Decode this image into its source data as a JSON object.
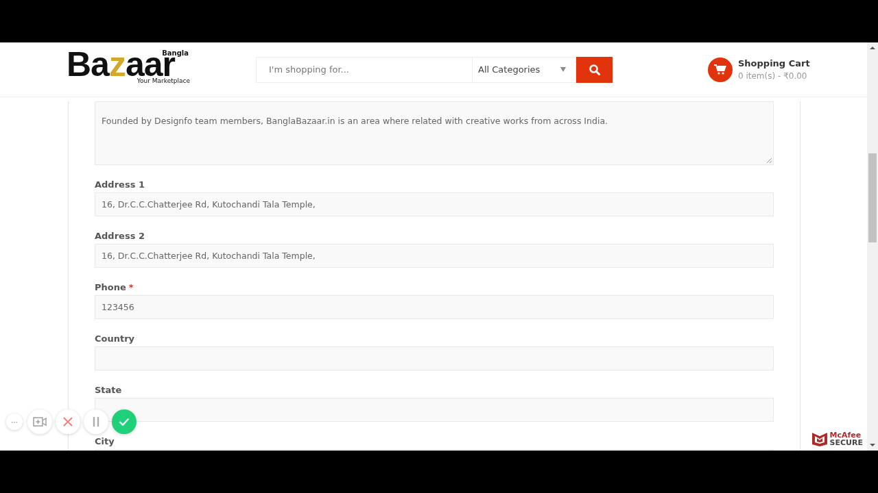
{
  "header": {
    "logo": {
      "small": "Bangla",
      "wordmark": [
        {
          "text": "Ba",
          "accent": false
        },
        {
          "text": "z",
          "accent": true
        },
        {
          "text": "aar",
          "accent": false
        }
      ],
      "tagline": "Your Marketplace"
    },
    "search": {
      "placeholder": "I'm shopping for...",
      "category": "All Categories"
    },
    "cart": {
      "title": "Shopping Cart",
      "summary": "0 item(s) - ₹0.00"
    }
  },
  "form": {
    "required_mark": "*",
    "fields": [
      {
        "kind": "textarea",
        "value": "Founded by Designfo team members, BanglaBazaar.in is an area where related with creative works from across India."
      },
      {
        "label": "Address 1",
        "kind": "input",
        "value": "16, Dr.C.C.Chatterjee Rd, Kutochandi Tala Temple,",
        "required": false
      },
      {
        "label": "Address 2",
        "kind": "input",
        "value": "16, Dr.C.C.Chatterjee Rd, Kutochandi Tala Temple,",
        "required": false
      },
      {
        "label": "Phone",
        "kind": "input",
        "value": "123456",
        "required": true
      },
      {
        "label": "Country",
        "kind": "input",
        "required": false
      },
      {
        "label": "State",
        "kind": "input",
        "required": false
      },
      {
        "label": "City",
        "kind": "input",
        "required": false
      }
    ]
  },
  "recorder": {
    "buttons": [
      {
        "kind": "more",
        "label": "···"
      },
      {
        "kind": "camera"
      },
      {
        "kind": "cancel"
      },
      {
        "kind": "pause"
      },
      {
        "kind": "done"
      }
    ]
  },
  "badge": {
    "brand": "McAfee",
    "label": "SECURE"
  }
}
